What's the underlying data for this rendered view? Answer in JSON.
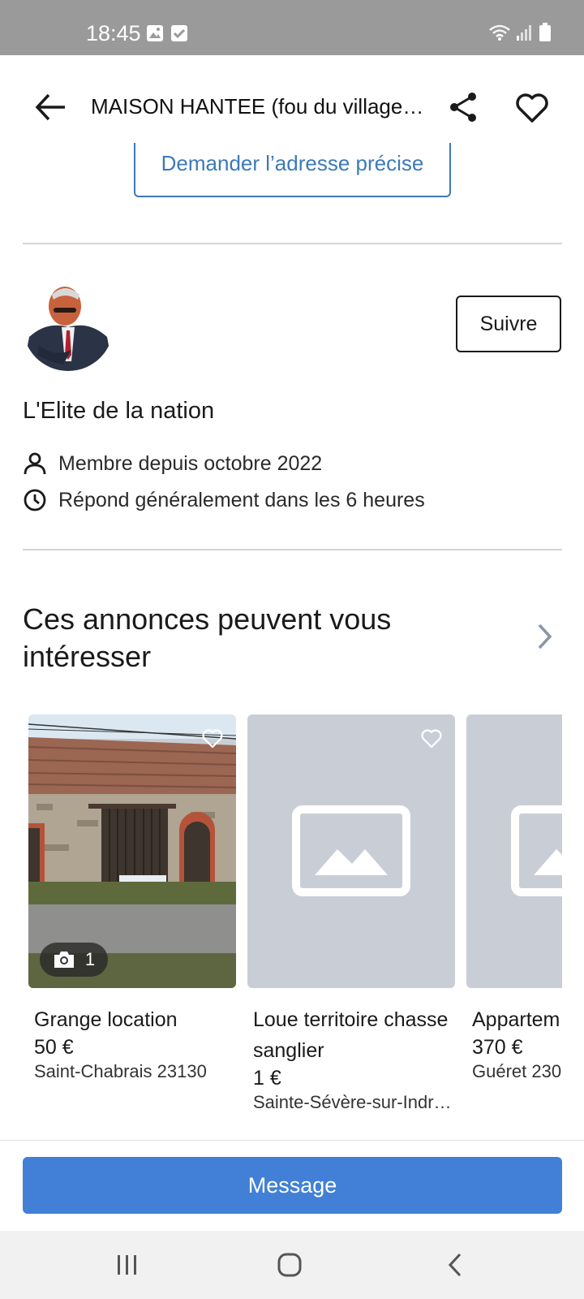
{
  "status_bar": {
    "time": "18:45",
    "icons": [
      "image-icon",
      "check-box-icon",
      "wifi-icon",
      "signal-icon",
      "battery-icon"
    ]
  },
  "app_bar": {
    "title": "MAISON HANTEE (fou du village…",
    "icons": [
      "back-arrow-icon",
      "share-icon",
      "heart-icon"
    ]
  },
  "address_button": "Demander l’adresse précise",
  "seller": {
    "follow_label": "Suivre",
    "name": "L'Elite de la nation",
    "member_since": "Membre depuis octobre 2022",
    "response_time": "Répond généralement dans les 6 heures"
  },
  "recommendations": {
    "title": "Ces annonces peuvent vous intéresser",
    "cards": [
      {
        "title": "Grange location",
        "price": "50 €",
        "location": "Saint-Chabrais 23130",
        "photo_count": "1"
      },
      {
        "title": "Loue territoire chasse sanglier",
        "price": "1 €",
        "location": "Sainte-Sévère-sur-Indr…"
      },
      {
        "title": "Appartem",
        "price": "370 €",
        "location": "Guéret 230"
      }
    ]
  },
  "message_button": "Message",
  "colors": {
    "accent": "#4180d6",
    "link": "#3d7ab8",
    "status_bar": "#9a9a9a"
  }
}
